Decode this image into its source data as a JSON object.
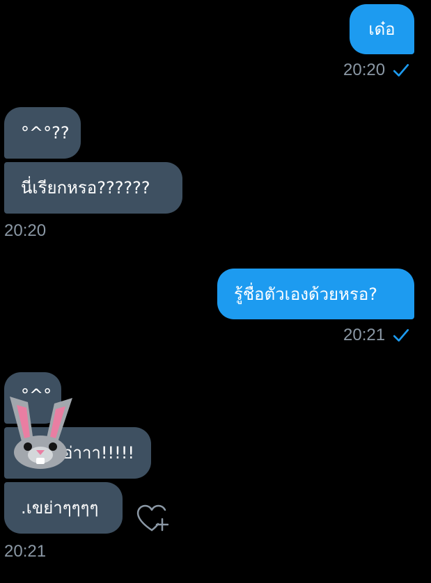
{
  "messages": [
    {
      "direction": "outgoing",
      "text": "เด๋อ"
    },
    {
      "direction": "outgoing",
      "time": "20:20",
      "read": true
    },
    {
      "direction": "incoming",
      "text": "°^°??"
    },
    {
      "direction": "incoming",
      "text": "นี่เรียกหรอ??????"
    },
    {
      "direction": "incoming",
      "time": "20:20"
    },
    {
      "direction": "outgoing",
      "text": "รู้ชื่อตัวเองด้วยหรอ?"
    },
    {
      "direction": "outgoing",
      "time": "20:21",
      "read": true
    },
    {
      "direction": "incoming",
      "text": "°^°"
    },
    {
      "direction": "incoming",
      "text": "อ่าาา!!!!!"
    },
    {
      "direction": "incoming",
      "text": ".เขย่าๆๆๆๆ"
    },
    {
      "direction": "incoming",
      "time": "20:21"
    }
  ],
  "icons": {
    "read_receipt": "checkmark-icon",
    "react": "heart-plus-icon",
    "sticker": "bunny-sticker"
  },
  "colors": {
    "background": "#000000",
    "outgoing_bubble": "#1d9bf0",
    "incoming_bubble": "#3e5061",
    "timestamp": "#8b98a5",
    "checkmark": "#1d9bf0"
  }
}
